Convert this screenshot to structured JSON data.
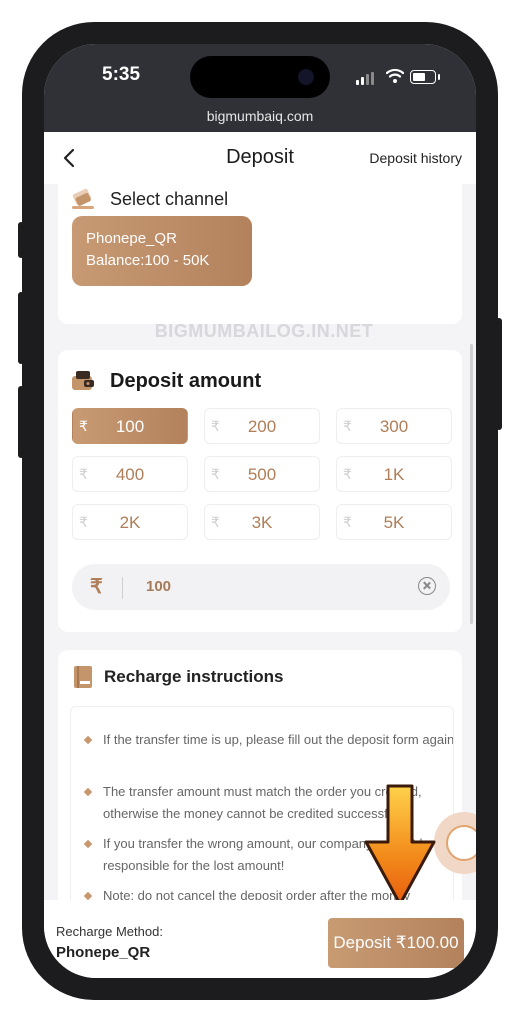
{
  "status_bar": {
    "time": "5:35",
    "url": "bigmumbaiq.com"
  },
  "nav": {
    "title": "Deposit",
    "history_link": "Deposit history"
  },
  "channel": {
    "section_title": "Select channel",
    "name": "Phonepe_QR",
    "balance": "Balance:100 - 50K"
  },
  "watermark": "BIGMUMBAILOG.IN.NET",
  "amount": {
    "section_title": "Deposit amount",
    "currency_symbol": "₹",
    "options": [
      "100",
      "200",
      "300",
      "400",
      "500",
      "1K",
      "2K",
      "3K",
      "5K"
    ],
    "selected": "100",
    "input_value": "100"
  },
  "instructions": {
    "section_title": "Recharge instructions",
    "items": [
      "If the transfer time is up, please fill out the deposit form again.",
      "The transfer amount must match the order you created, otherwise the money cannot be credited successfully.",
      "If you transfer the wrong amount, our company will not be responsible for the lost amount!",
      "Note: do not cancel the deposit order after the money"
    ]
  },
  "footer": {
    "method_label": "Recharge Method:",
    "method_value": "Phonepe_QR",
    "deposit_button": "Deposit ₹100.00"
  },
  "colors": {
    "accent": "#b8875f",
    "arrow": "#f28a1a"
  }
}
